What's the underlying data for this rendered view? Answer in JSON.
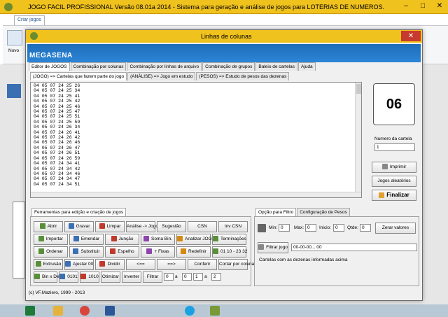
{
  "main_window": {
    "title": "JOGO FACIL PROFISSIONAL  Versão 08.01a  2014 - Sistema para geração e análise de jogos para LOTERIAS DE NUMEROS.",
    "ribbon_tab": "Criar jogos",
    "ribbon_first": "Novo"
  },
  "dialog": {
    "title": "Linhas de colunas",
    "banner": "MEGASENA",
    "close_icon": "close-icon"
  },
  "top_tabs": [
    "Editor de JOGOS",
    "Combinação por colunas",
    "Combinação por linhas de arquivo",
    "Combinação de grupos",
    "Baleio de cartelas",
    "Ajuda"
  ],
  "sub_tabs": [
    "(JOGO) => Cartelas que fazem parte do jogo",
    "(ANÁLISE) => Jogo em estudo",
    "(PESOS) => Estudo de pesos das dezenas"
  ],
  "game_lines": [
    "04 05 07 24 25 26",
    "04 05 07 24 25 34",
    "04 05 07 24 25 41",
    "04 05 07 24 25 42",
    "04 05 07 24 25 46",
    "04 05 07 24 25 47",
    "04 05 07 24 25 51",
    "04 05 07 24 25 59",
    "04 05 07 24 26 34",
    "04 05 07 24 26 41",
    "04 05 07 24 26 42",
    "04 05 07 24 26 46",
    "04 05 07 24 26 47",
    "04 05 07 24 26 51",
    "04 05 07 24 26 59",
    "04 05 07 24 34 41",
    "04 05 07 24 34 42",
    "04 05 07 24 34 46",
    "04 05 07 24 34 47",
    "04 05 07 24 34 51"
  ],
  "right_panel": {
    "count": "06",
    "cartela_label": "Numero da cartela",
    "cartela_value": "1",
    "imprimir": "Imprimir",
    "aleatorios": "Jogos aleatórios",
    "finalizar": "Finalizar"
  },
  "tools": {
    "tab": "Ferramentas para edição e criação de  jogos",
    "row1": [
      "Abrir",
      "Gravar",
      "Limpar",
      "Análise -> Jogo",
      "Sugestão",
      "CSN",
      "Inv CSN"
    ],
    "row2": [
      "Importar",
      "Emendar",
      "Junção",
      "Soma Bin.",
      "Analizar JOGO",
      "Terminações"
    ],
    "row3": [
      "Ordenar",
      "Substituir",
      "Espelho",
      "+ Fixas",
      "Redefinir",
      "01 10 - 23 32"
    ],
    "row4": [
      "Extrusão",
      "Ajustar 00",
      "Dividir",
      "<==",
      "==>",
      "Conferir",
      "Cortar por coluna"
    ],
    "row5": [
      "Bin x Dec.",
      "0101",
      "1010",
      "Otimizar",
      "Inverter",
      "Filtrar",
      "0",
      "a",
      "0",
      "1",
      "a",
      "2"
    ]
  },
  "filter": {
    "tabs": [
      "Opção para Filtro",
      "Configuração de Pesos"
    ],
    "min_label": "Min:",
    "min": "0",
    "max_label": "Max:",
    "max": "0",
    "inicio_label": "Inicio:",
    "inicio": "0",
    "qtde_label": "Qtde:",
    "qtde": "0",
    "zerar": "Zerar valores",
    "filtrar": "Filtrar jogo",
    "pattern": "00-00-00... 00",
    "info": "Cartelas com as dezenas  informadas acima"
  },
  "footer": "(c) VF.Maziero, 1999 - 2013",
  "colors": {
    "title_bar": "#f0c21d",
    "banner": "#1e6db8",
    "close": "#c73a2e"
  }
}
